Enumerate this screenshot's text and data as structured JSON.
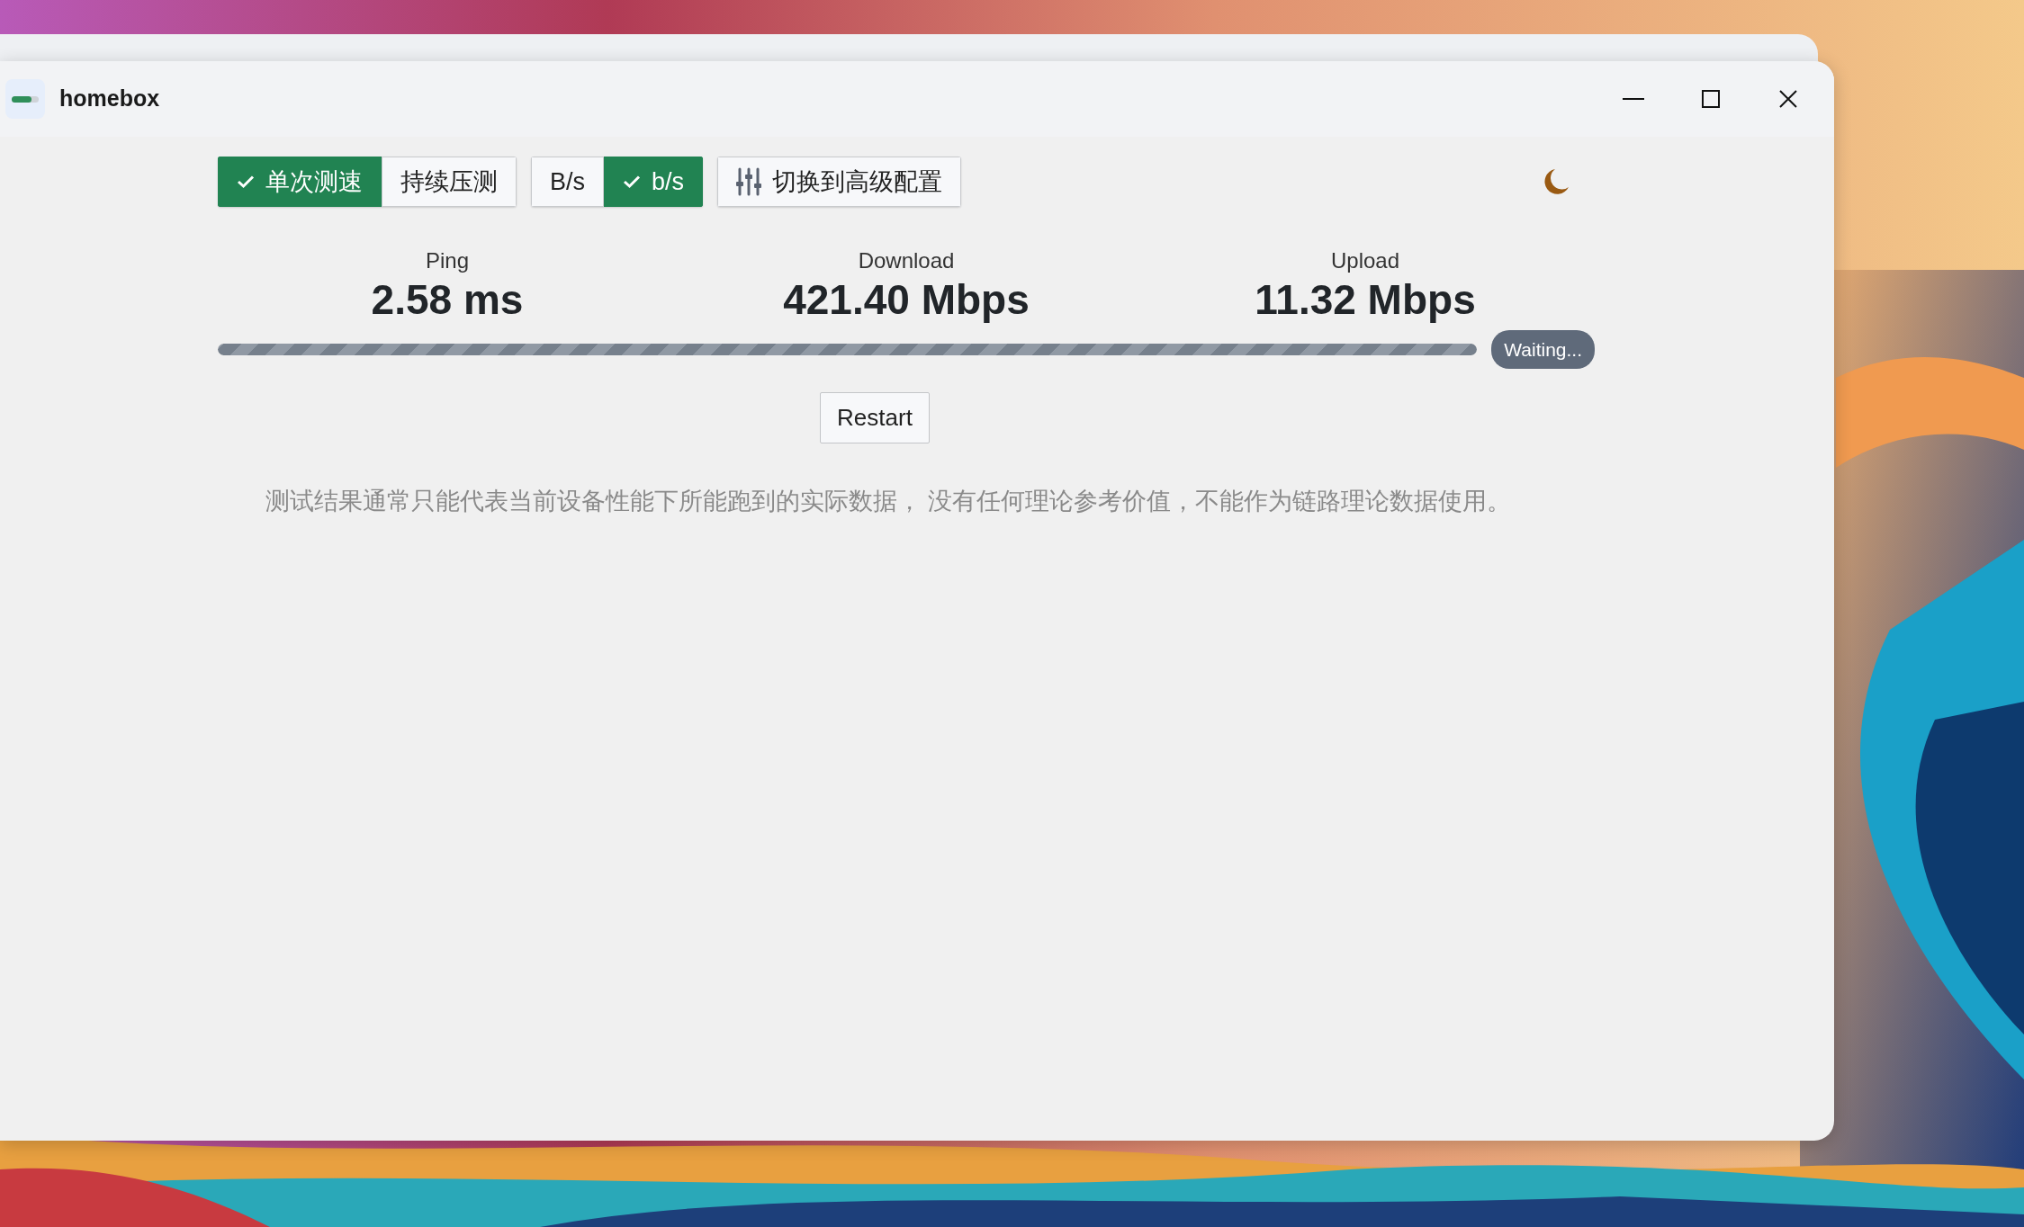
{
  "window": {
    "title": "homebox"
  },
  "mode_toggle": [
    {
      "label": "单次测速",
      "selected": true
    },
    {
      "label": "持续压测",
      "selected": false
    }
  ],
  "unit_toggle": [
    {
      "label": "B/s",
      "selected": false
    },
    {
      "label": "b/s",
      "selected": true
    }
  ],
  "advanced_button": {
    "label": "切换到高级配置"
  },
  "metrics": [
    {
      "label": "Ping",
      "value": "2.58 ms"
    },
    {
      "label": "Download",
      "value": "421.40 Mbps"
    },
    {
      "label": "Upload",
      "value": "11.32 Mbps"
    }
  ],
  "progress": {
    "level": 1,
    "status": "Waiting..."
  },
  "restart_button": {
    "label": "Restart"
  },
  "note": "测试结果通常只能代表当前设备性能下所能跑到的实际数据， 没有任何理论参考价值，不能作为链路理论数据使用。"
}
